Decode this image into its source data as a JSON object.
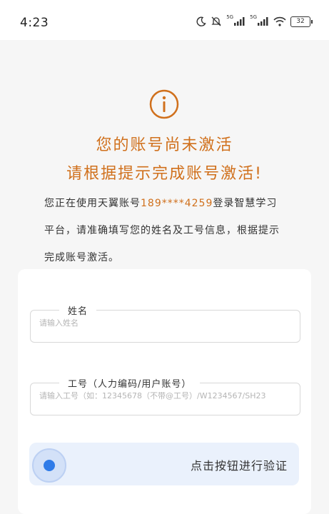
{
  "status_bar": {
    "time": "4:23",
    "signal1_label": "5G",
    "signal2_label": "5G",
    "battery": "32",
    "icons": [
      "moon-icon",
      "mute-icon",
      "signal-icon",
      "signal-icon",
      "wifi-icon",
      "battery-icon"
    ]
  },
  "notice": {
    "icon": "info-icon",
    "headline_1": "您的账号尚未激活",
    "headline_2": "请根据提示完成账号激活!",
    "desc_prefix": "您正在使用天翼账号",
    "phone": "189****4259",
    "desc_suffix": "登录智慧学习平台，请准确填写您的姓名及工号信息，根据提示完成账号激活。"
  },
  "form": {
    "name_label": "姓名",
    "name_placeholder": "请输入姓名",
    "id_label": "工号（人力编码/用户账号）",
    "id_placeholder": "请输入工号（如：12345678（不带@工号）/W1234567/SH23"
  },
  "verify": {
    "label": "点击按钮进行验证"
  },
  "colors": {
    "accent_orange": "#d0701c",
    "verify_bg": "#eaf1fc",
    "knob_blue": "#2f7be8"
  }
}
